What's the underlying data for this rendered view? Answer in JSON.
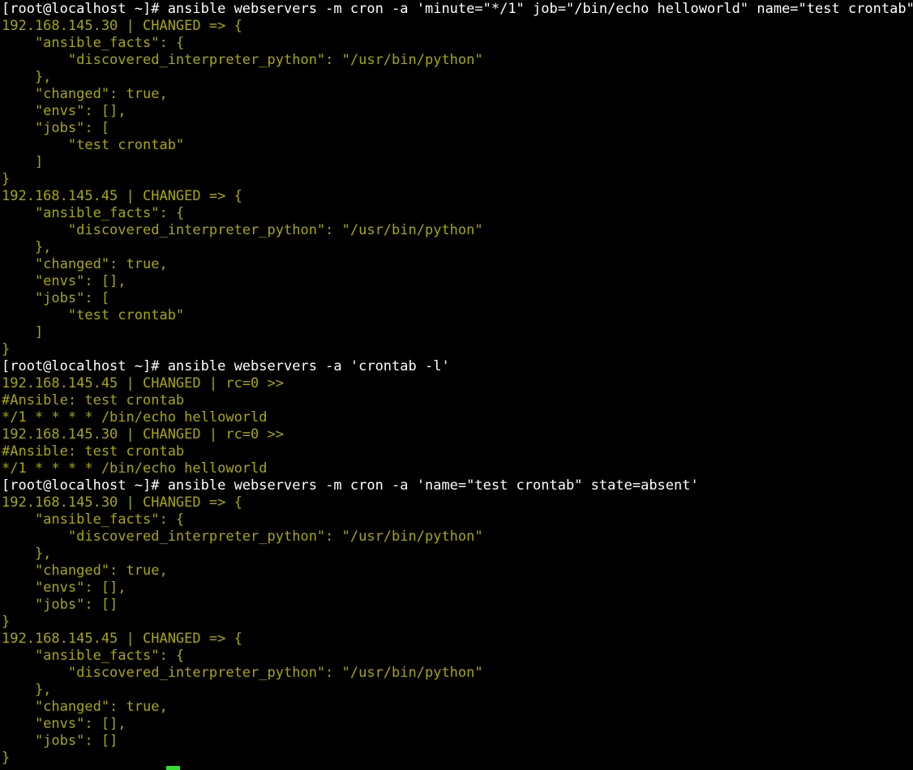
{
  "terminal": {
    "title": "root@localhost:~",
    "colors": {
      "background": "#000000",
      "command_text": "#ffffff",
      "output_text": "#a8a800",
      "cursor": "#33dd33"
    },
    "prompt": "[root@localhost ~]#",
    "user": "root",
    "host": "localhost",
    "cwd": "~",
    "cursor_visible": true,
    "lines": [
      {
        "type": "cmd",
        "text": "[root@localhost ~]# ansible webservers -m cron -a 'minute=\"*/1\" job=\"/bin/echo helloworld\" name=\"test crontab\"'"
      },
      {
        "type": "out",
        "text": "192.168.145.30 | CHANGED => {"
      },
      {
        "type": "out",
        "text": "    \"ansible_facts\": {"
      },
      {
        "type": "out",
        "text": "        \"discovered_interpreter_python\": \"/usr/bin/python\""
      },
      {
        "type": "out",
        "text": "    },"
      },
      {
        "type": "out",
        "text": "    \"changed\": true,"
      },
      {
        "type": "out",
        "text": "    \"envs\": [],"
      },
      {
        "type": "out",
        "text": "    \"jobs\": ["
      },
      {
        "type": "out",
        "text": "        \"test crontab\""
      },
      {
        "type": "out",
        "text": "    ]"
      },
      {
        "type": "out",
        "text": "}"
      },
      {
        "type": "out",
        "text": "192.168.145.45 | CHANGED => {"
      },
      {
        "type": "out",
        "text": "    \"ansible_facts\": {"
      },
      {
        "type": "out",
        "text": "        \"discovered_interpreter_python\": \"/usr/bin/python\""
      },
      {
        "type": "out",
        "text": "    },"
      },
      {
        "type": "out",
        "text": "    \"changed\": true,"
      },
      {
        "type": "out",
        "text": "    \"envs\": [],"
      },
      {
        "type": "out",
        "text": "    \"jobs\": ["
      },
      {
        "type": "out",
        "text": "        \"test crontab\""
      },
      {
        "type": "out",
        "text": "    ]"
      },
      {
        "type": "out",
        "text": "}"
      },
      {
        "type": "cmd",
        "text": "[root@localhost ~]# ansible webservers -a 'crontab -l'"
      },
      {
        "type": "out",
        "text": "192.168.145.45 | CHANGED | rc=0 >>"
      },
      {
        "type": "out",
        "text": "#Ansible: test crontab"
      },
      {
        "type": "out",
        "text": "*/1 * * * * /bin/echo helloworld"
      },
      {
        "type": "out",
        "text": "192.168.145.30 | CHANGED | rc=0 >>"
      },
      {
        "type": "out",
        "text": "#Ansible: test crontab"
      },
      {
        "type": "out",
        "text": "*/1 * * * * /bin/echo helloworld"
      },
      {
        "type": "cmd",
        "text": "[root@localhost ~]# ansible webservers -m cron -a 'name=\"test crontab\" state=absent'"
      },
      {
        "type": "out",
        "text": "192.168.145.30 | CHANGED => {"
      },
      {
        "type": "out",
        "text": "    \"ansible_facts\": {"
      },
      {
        "type": "out",
        "text": "        \"discovered_interpreter_python\": \"/usr/bin/python\""
      },
      {
        "type": "out",
        "text": "    },"
      },
      {
        "type": "out",
        "text": "    \"changed\": true,"
      },
      {
        "type": "out",
        "text": "    \"envs\": [],"
      },
      {
        "type": "out",
        "text": "    \"jobs\": []"
      },
      {
        "type": "out",
        "text": "}"
      },
      {
        "type": "out",
        "text": "192.168.145.45 | CHANGED => {"
      },
      {
        "type": "out",
        "text": "    \"ansible_facts\": {"
      },
      {
        "type": "out",
        "text": "        \"discovered_interpreter_python\": \"/usr/bin/python\""
      },
      {
        "type": "out",
        "text": "    },"
      },
      {
        "type": "out",
        "text": "    \"changed\": true,"
      },
      {
        "type": "out",
        "text": "    \"envs\": [],"
      },
      {
        "type": "out",
        "text": "    \"jobs\": []"
      },
      {
        "type": "out",
        "text": "}"
      }
    ]
  }
}
